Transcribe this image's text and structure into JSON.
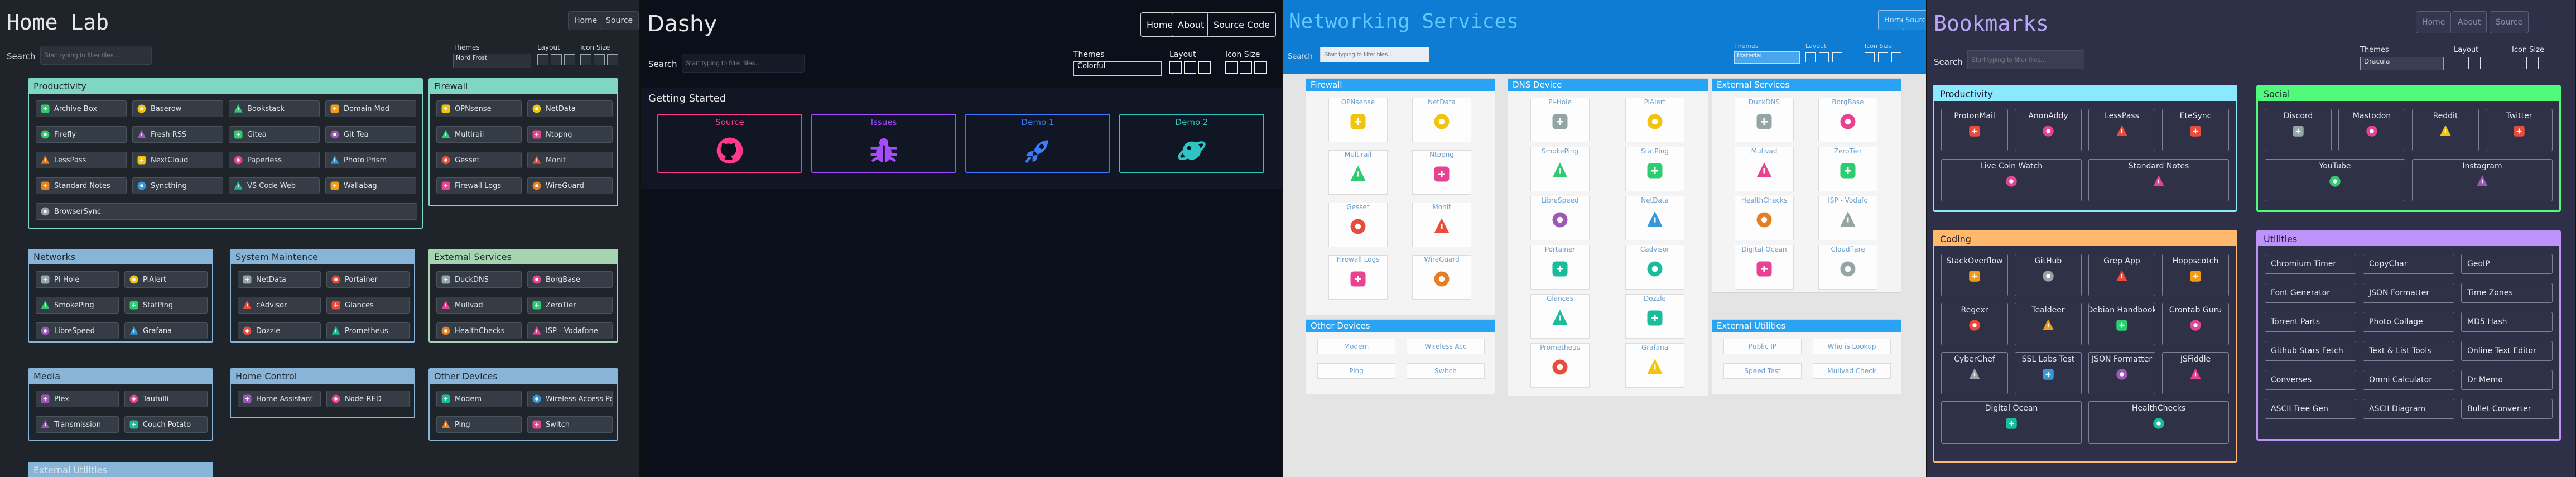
{
  "p1": {
    "title": "Home Lab",
    "nav": [
      "Home",
      "Source"
    ],
    "search_label": "Search",
    "search_placeholder": "Start typing to filter tiles...",
    "themes_label": "Themes",
    "theme_value": "Nord Frost",
    "layout_label": "Layout",
    "iconsize_label": "Icon Size",
    "sections": [
      {
        "name": "Productivity",
        "items": [
          "Archive Box",
          "Baserow",
          "Bookstack",
          "Domain Mod",
          "Firefly",
          "Fresh RSS",
          "Gitea",
          "Git Tea",
          "LessPass",
          "NextCloud",
          "Paperless",
          "Photo Prism",
          "Standard Notes",
          "Syncthing",
          "VS Code Web",
          "Wallabag",
          "BrowserSync"
        ]
      },
      {
        "name": "Firewall",
        "items": [
          "OPNsense",
          "NetData",
          "Multirail",
          "Ntopng",
          "Gesset",
          "Monit",
          "Firewall Logs",
          "WireGuard"
        ]
      },
      {
        "name": "Networks",
        "items": [
          "Pi-Hole",
          "PiAlert",
          "SmokePing",
          "StatPing",
          "LibreSpeed",
          "Grafana"
        ]
      },
      {
        "name": "System Maintence",
        "items": [
          "NetData",
          "Portainer",
          "cAdvisor",
          "Glances",
          "Dozzle",
          "Prometheus"
        ]
      },
      {
        "name": "External Services",
        "items": [
          "DuckDNS",
          "BorgBase",
          "Mullvad",
          "ZeroTier",
          "HealthChecks",
          "ISP - Vodafone"
        ]
      },
      {
        "name": "Media",
        "items": [
          "Plex",
          "Tautulli",
          "Transmission",
          "Couch Potato"
        ]
      },
      {
        "name": "Home Control",
        "items": [
          "Home Assistant",
          "Node-RED"
        ]
      },
      {
        "name": "Other Devices",
        "items": [
          "Modem",
          "Wireless Access Point",
          "Ping",
          "Switch"
        ]
      },
      {
        "name": "External Utilities",
        "items": []
      }
    ]
  },
  "p2": {
    "title": "Dashy",
    "nav": [
      "Home",
      "About",
      "Source Code"
    ],
    "search_label": "Search",
    "search_placeholder": "Start typing to filter tiles...",
    "themes_label": "Themes",
    "theme_value": "Colorful",
    "layout_label": "Layout",
    "iconsize_label": "Icon Size",
    "group": "Getting Started",
    "tiles": [
      "Source",
      "Issues",
      "Demo 1",
      "Demo 2"
    ]
  },
  "p3": {
    "title": "Networking Services",
    "nav": [
      "Home",
      "Source"
    ],
    "search_label": "Search",
    "search_placeholder": "Start typing to filter tiles...",
    "themes_label": "Themes",
    "theme_value": "Material",
    "layout_label": "Layout",
    "iconsize_label": "Icon Size",
    "firewall": {
      "name": "Firewall",
      "items": [
        "OPNsense",
        "NetData",
        "Multirail",
        "Ntopng",
        "Gesset",
        "Monit",
        "Firewall Logs",
        "WireGuard"
      ]
    },
    "other": {
      "name": "Other Devices",
      "items": [
        "Modem",
        "Wireless Acc",
        "Ping",
        "Switch"
      ]
    },
    "dns": {
      "name": "DNS Device",
      "items": [
        "Pi-Hole",
        "PiAlert",
        "SmokePing",
        "StatPing",
        "LibreSpeed",
        "NetData",
        "Portainer",
        "Cadvisor",
        "Glances",
        "Dozzle",
        "Prometheus",
        "Grafana"
      ]
    },
    "ext": {
      "name": "External Services",
      "items": [
        "DuckDNS",
        "BorgBase",
        "Mullvad",
        "ZeroTier",
        "HealthChecks",
        "ISP - Vodafo",
        "Digital Ocean",
        "Cloudflare"
      ]
    },
    "util": {
      "name": "External Utilities",
      "items": [
        "Public IP",
        "Who is Lookup",
        "Speed Test",
        "Mullvad Check"
      ]
    }
  },
  "p4": {
    "title": "Bookmarks",
    "nav": [
      "Home",
      "About",
      "Source"
    ],
    "search_label": "Search",
    "search_placeholder": "Start typing to filter tiles...",
    "themes_label": "Themes",
    "theme_value": "Dracula",
    "layout_label": "Layout",
    "iconsize_label": "Icon Size",
    "productivity": {
      "name": "Productivity",
      "items": [
        "ProtonMail",
        "AnonAddy",
        "LessPass",
        "EteSync",
        "Live Coin Watch",
        "Standard Notes"
      ]
    },
    "social": {
      "name": "Social",
      "items": [
        "Discord",
        "Mastodon",
        "Reddit",
        "Twitter",
        "YouTube",
        "Instagram"
      ]
    },
    "coding": {
      "name": "Coding",
      "items": [
        "StackOverflow",
        "GitHub",
        "Grep App",
        "Hoppscotch",
        "Regexr",
        "Tealdeer",
        "Debian Handbook",
        "Crontab Guru",
        "CyberChef",
        "SSL Labs Test",
        "JSON Formatter",
        "JSFiddle",
        "Digital Ocean",
        "HealthChecks"
      ]
    },
    "utilities": {
      "name": "Utilities",
      "items": [
        "Chromium Timer",
        "CopyChar",
        "GeoIP",
        "Font Generator",
        "JSON Formatter",
        "Time Zones",
        "Torrent Parts",
        "Photo Collage",
        "MD5 Hash",
        "Github Stars Fetch",
        "Text & List Tools",
        "Online Text Editor",
        "Converses",
        "Omni Calculator",
        "Dr Memo",
        "ASCII Tree Gen",
        "ASCII Diagram",
        "Bullet Converter"
      ]
    }
  },
  "colors": {
    "p1_productivity": "#7fd6c2",
    "p1_firewall": "#7fd6c2",
    "p1_networks": "#88b4d8",
    "p1_system": "#88b4d8",
    "p1_external": "#a6d4b0",
    "p1_media": "#88b4d8",
    "p1_home": "#88b4d8",
    "p1_other": "#88b4d8",
    "p2_tiles": [
      "#ff3a8a",
      "#a64cff",
      "#3a7bff",
      "#2ec4c4"
    ],
    "p4_productivity": "#8be9fd",
    "p4_social": "#50fa7b",
    "p4_coding": "#ffb86c",
    "p4_utilities": "#bd93f9"
  }
}
